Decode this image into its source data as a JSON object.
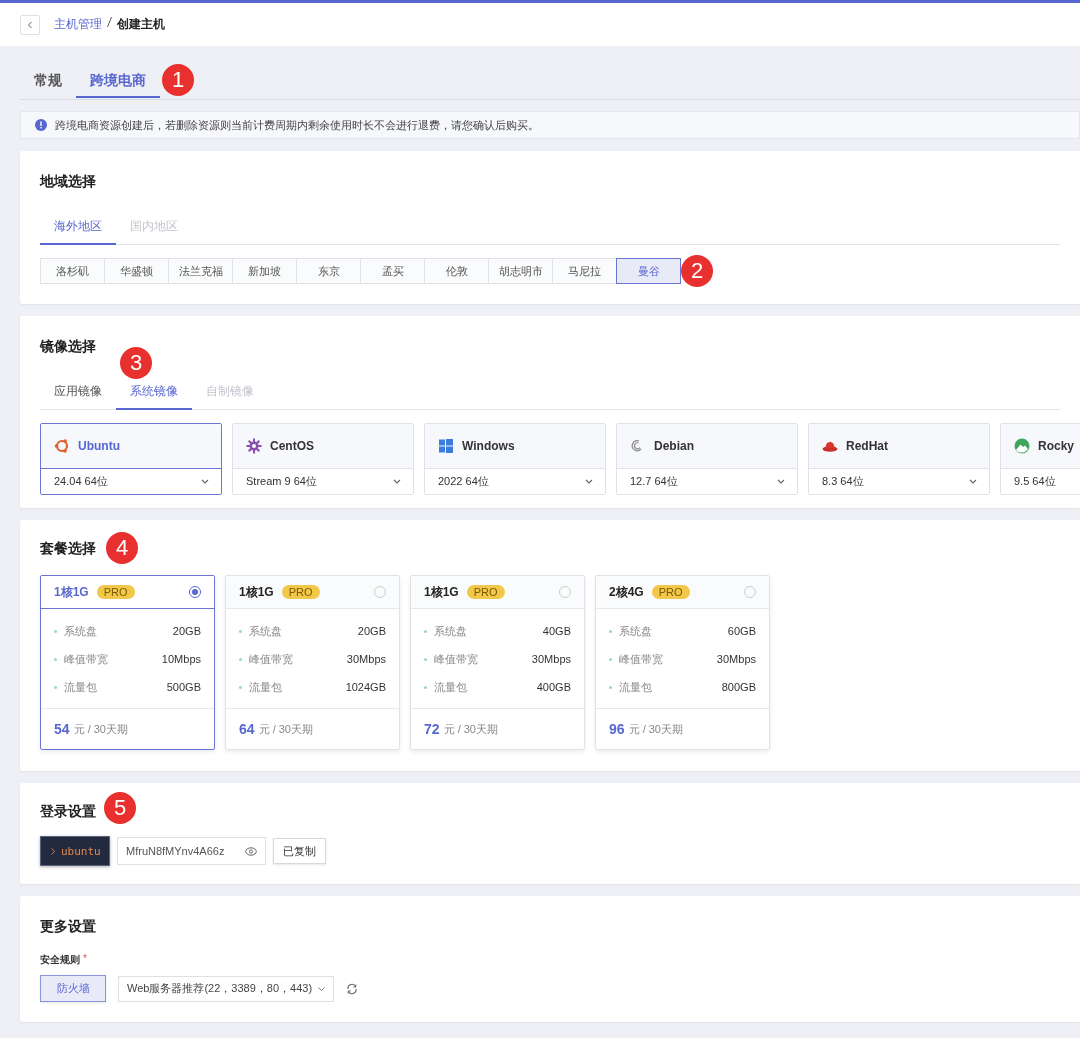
{
  "breadcrumb": {
    "parent": "主机管理",
    "current": "创建主机"
  },
  "tabs": [
    {
      "label": "常规",
      "selected": false
    },
    {
      "label": "跨境电商",
      "selected": true,
      "marker": "1"
    }
  ],
  "notice": "跨境电商资源创建后，若删除资源则当前计费周期内剩余使用时长不会进行退费，请您确认后购买。",
  "region": {
    "title": "地域选择",
    "tabs": [
      {
        "label": "海外地区",
        "selected": true,
        "disabled": false
      },
      {
        "label": "国内地区",
        "selected": false,
        "disabled": true
      }
    ],
    "cities": [
      {
        "label": "洛杉矶",
        "selected": false
      },
      {
        "label": "华盛顿",
        "selected": false
      },
      {
        "label": "法兰克福",
        "selected": false
      },
      {
        "label": "新加坡",
        "selected": false
      },
      {
        "label": "东京",
        "selected": false
      },
      {
        "label": "孟买",
        "selected": false
      },
      {
        "label": "伦敦",
        "selected": false
      },
      {
        "label": "胡志明市",
        "selected": false
      },
      {
        "label": "马尼拉",
        "selected": false
      },
      {
        "label": "曼谷",
        "selected": true,
        "marker": "2"
      }
    ]
  },
  "image": {
    "title": "镜像选择",
    "tabs": [
      {
        "label": "应用镜像",
        "selected": false,
        "disabled": false
      },
      {
        "label": "系统镜像",
        "selected": true,
        "disabled": false,
        "marker": "3"
      },
      {
        "label": "自制镜像",
        "selected": false,
        "disabled": true
      }
    ],
    "systems": [
      {
        "kind": "ubuntu",
        "name": "Ubuntu",
        "version": "24.04 64位",
        "selected": true
      },
      {
        "kind": "centos",
        "name": "CentOS",
        "version": "Stream 9 64位",
        "selected": false
      },
      {
        "kind": "windows",
        "name": "Windows",
        "version": "2022 64位",
        "selected": false
      },
      {
        "kind": "debian",
        "name": "Debian",
        "version": "12.7 64位",
        "selected": false
      },
      {
        "kind": "redhat",
        "name": "RedHat",
        "version": "8.3 64位",
        "selected": false
      },
      {
        "kind": "rocky",
        "name": "Rocky",
        "version": "9.5 64位",
        "selected": false
      }
    ]
  },
  "plans": {
    "title": "套餐选择",
    "marker": "4",
    "items": [
      {
        "name": "1核1G",
        "badge": "PRO",
        "selected": true,
        "specs": [
          {
            "label": "系统盘",
            "value": "20GB"
          },
          {
            "label": "峰值带宽",
            "value": "10Mbps"
          },
          {
            "label": "流量包",
            "value": "500GB"
          }
        ],
        "price": "54",
        "unit": "元 / 30天期"
      },
      {
        "name": "1核1G",
        "badge": "PRO",
        "selected": false,
        "specs": [
          {
            "label": "系统盘",
            "value": "20GB"
          },
          {
            "label": "峰值带宽",
            "value": "30Mbps"
          },
          {
            "label": "流量包",
            "value": "1024GB"
          }
        ],
        "price": "64",
        "unit": "元 / 30天期"
      },
      {
        "name": "1核1G",
        "badge": "PRO",
        "selected": false,
        "specs": [
          {
            "label": "系统盘",
            "value": "40GB"
          },
          {
            "label": "峰值带宽",
            "value": "30Mbps"
          },
          {
            "label": "流量包",
            "value": "400GB"
          }
        ],
        "price": "72",
        "unit": "元 / 30天期"
      },
      {
        "name": "2核4G",
        "badge": "PRO",
        "selected": false,
        "specs": [
          {
            "label": "系统盘",
            "value": "60GB"
          },
          {
            "label": "峰值带宽",
            "value": "30Mbps"
          },
          {
            "label": "流量包",
            "value": "800GB"
          }
        ],
        "price": "96",
        "unit": "元 / 30天期"
      }
    ]
  },
  "login": {
    "title": "登录设置",
    "marker": "5",
    "user": "ubuntu",
    "password": "MfruN8fMYnv4A66z",
    "copy_button": "已复制"
  },
  "more": {
    "title": "更多设置",
    "rule_label": "安全规则",
    "required_mark": "*",
    "firewall_button": "防火墙",
    "rule_select": "Web服务器推荐(22，3389，80，443)"
  }
}
